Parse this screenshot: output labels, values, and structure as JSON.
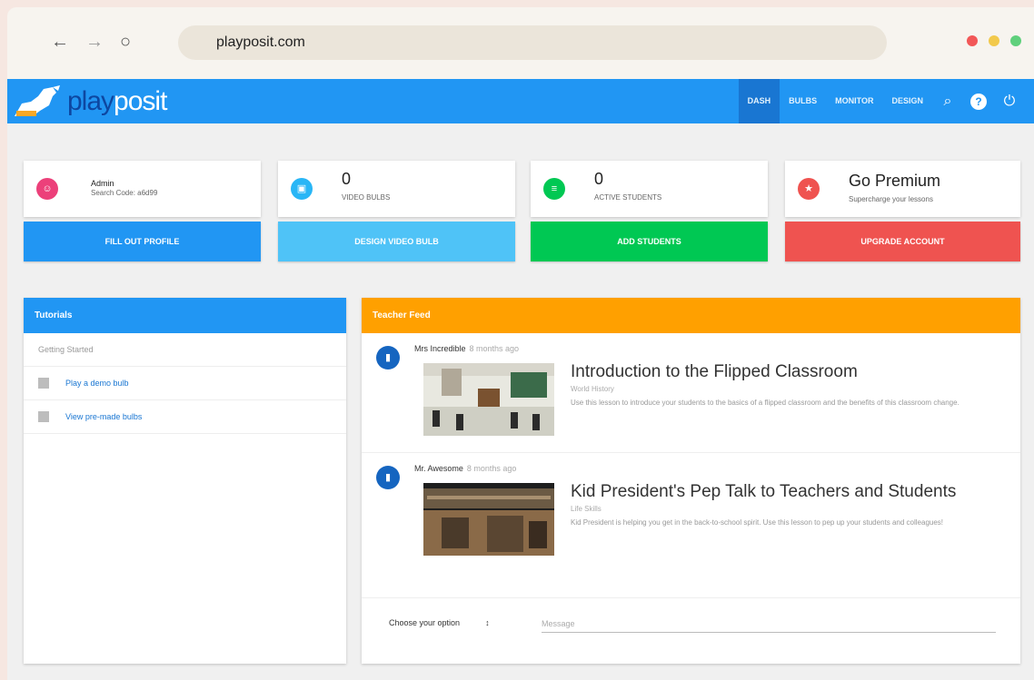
{
  "browser": {
    "url": "playposit.com",
    "back_icon": "←",
    "forward_icon": "→",
    "reload_icon": "○",
    "dots": [
      "#f25757",
      "#f2c94c",
      "#5fd07c"
    ]
  },
  "app": {
    "logo": {
      "part1": "play",
      "part2": "posit"
    },
    "nav": {
      "tabs": [
        "DASH",
        "BULBS",
        "MONITOR",
        "DESIGN"
      ],
      "active": "DASH",
      "search_icon": "⌕",
      "help_icon": "?",
      "power_icon": "⏻"
    },
    "stats": {
      "profile": {
        "name": "Admin",
        "code": "Search Code: a6d99",
        "color": "#ec407a"
      },
      "bulbs": {
        "value": "0",
        "label": "VIDEO BULBS",
        "color": "#29b6f6"
      },
      "students": {
        "value": "0",
        "label": "ACTIVE STUDENTS",
        "color": "#00c853"
      },
      "premium": {
        "value": "Go Premium",
        "label": "Supercharge your lessons",
        "color": "#ef5350",
        "icon": "★"
      }
    },
    "actions": {
      "profile": {
        "label": "FILL OUT PROFILE",
        "color": "#2196f3"
      },
      "design": {
        "label": "DESIGN VIDEO BULB",
        "color": "#4fc3f7"
      },
      "students": {
        "label": "ADD STUDENTS",
        "color": "#00c853"
      },
      "upgrade": {
        "label": "UPGRADE ACCOUNT",
        "color": "#ef5350"
      }
    },
    "tutorials": {
      "title": "Tutorials",
      "color": "#2196f3",
      "section": "Getting Started",
      "items": [
        "Play a demo bulb",
        "View pre-made bulbs"
      ]
    },
    "feed": {
      "title": "Teacher Feed",
      "color": "#ffa000",
      "items": [
        {
          "author": "Mrs Incredible",
          "when": "8 months ago",
          "title": "Introduction to the Flipped Classroom",
          "subject": "World History",
          "description": "Use this lesson to introduce your students to the basics of a flipped classroom and the benefits of this classroom change."
        },
        {
          "author": "Mr. Awesome",
          "when": "8 months ago",
          "title": "Kid President's Pep Talk to Teachers and Students",
          "subject": "Life Skills",
          "description": "Kid President is helping you get in the back-to-school spirit. Use this lesson to pep up your students and colleagues!"
        }
      ],
      "composer": {
        "select_label": "Choose your option",
        "select_arrow": "↕",
        "message_placeholder": "Message"
      }
    }
  }
}
